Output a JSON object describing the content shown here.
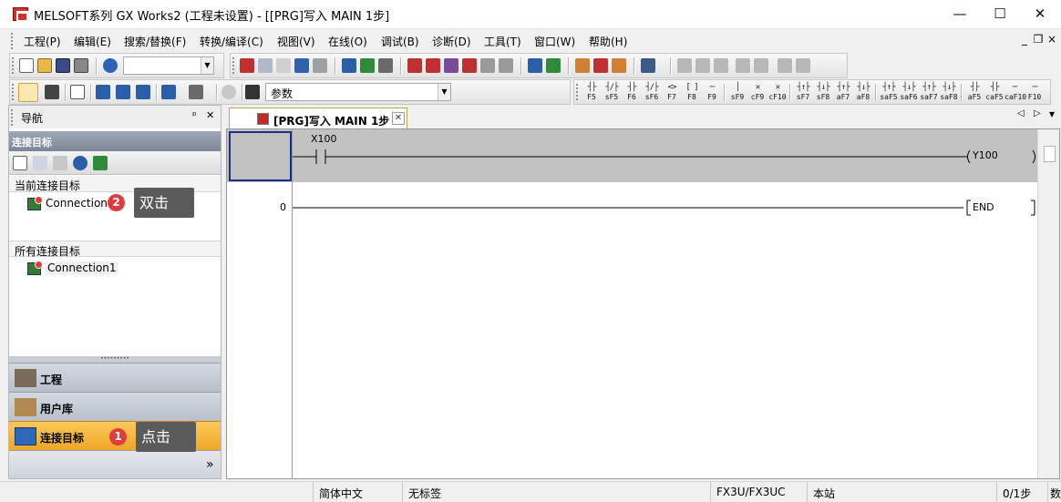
{
  "window": {
    "title": "MELSOFT系列 GX Works2 (工程未设置) - [[PRG]写入 MAIN 1步]",
    "minimize": "—",
    "maximize": "☐",
    "close": "✕"
  },
  "menu": {
    "items": [
      "工程(P)",
      "编辑(E)",
      "搜索/替换(F)",
      "转换/编译(C)",
      "视图(V)",
      "在线(O)",
      "调试(B)",
      "诊断(D)",
      "工具(T)",
      "窗口(W)",
      "帮助(H)"
    ],
    "mdi_minimize": "_",
    "mdi_restore": "❐",
    "mdi_close": "×"
  },
  "toolbar2": {
    "param_combo": "参数"
  },
  "ladder_keys": [
    {
      "sym": "┤├",
      "key": "F5"
    },
    {
      "sym": "┤/├",
      "key": "sF5"
    },
    {
      "sym": "┤├",
      "key": "F6"
    },
    {
      "sym": "┤/├",
      "key": "sF6"
    },
    {
      "sym": "<>",
      "key": "F7"
    },
    {
      "sym": "[ ]",
      "key": "F8"
    },
    {
      "sym": "─",
      "key": "F9"
    },
    {
      "sym": "│",
      "key": "sF9"
    },
    {
      "sym": "✕",
      "key": "cF9"
    },
    {
      "sym": "✕",
      "key": "cF10"
    },
    {
      "sym": "┤↑├",
      "key": "sF7"
    },
    {
      "sym": "┤↓├",
      "key": "sF8"
    },
    {
      "sym": "┤↑├",
      "key": "aF7"
    },
    {
      "sym": "┤↓├",
      "key": "aF8"
    },
    {
      "sym": "┤↑├",
      "key": "saF5"
    },
    {
      "sym": "┤↓├",
      "key": "saF6"
    },
    {
      "sym": "┤↑├",
      "key": "saF7"
    },
    {
      "sym": "┤↓├",
      "key": "saF8"
    },
    {
      "sym": "┤├",
      "key": "aF5"
    },
    {
      "sym": "┤├",
      "key": "caF5"
    },
    {
      "sym": "─",
      "key": "caF10"
    },
    {
      "sym": "─",
      "key": "F10"
    }
  ],
  "nav": {
    "title": "导航",
    "pin": "ᵖ",
    "close": "✕",
    "subheader": "连接目标",
    "current_section": "当前连接目标",
    "current_item": "Connection1",
    "all_section": "所有连接目标",
    "all_item": "Connection1",
    "panes": [
      "工程",
      "用户库",
      "连接目标"
    ],
    "expand": "»"
  },
  "annotations": {
    "step1_number": "1",
    "step1_text": "点击",
    "step2_number": "2",
    "step2_text": "双击"
  },
  "tab": {
    "label": "[PRG]写入 MAIN 1步",
    "close": "✕",
    "nav_prev": "◁",
    "nav_next": "▷",
    "nav_menu": "▾"
  },
  "ladder": {
    "rung0_contact": "X100",
    "rung0_coil": "Y100",
    "rung1_step": "0",
    "rung1_instruction": "END"
  },
  "status": {
    "language": "简体中文",
    "label": "无标签",
    "plc": "FX3U/FX3UC",
    "station": "本站",
    "steps": "0/1步",
    "extra": "数"
  },
  "colors": {
    "highlight_pane": "#f5b332",
    "badge": "#e23b3b",
    "cursor": "#1a2f8a"
  }
}
